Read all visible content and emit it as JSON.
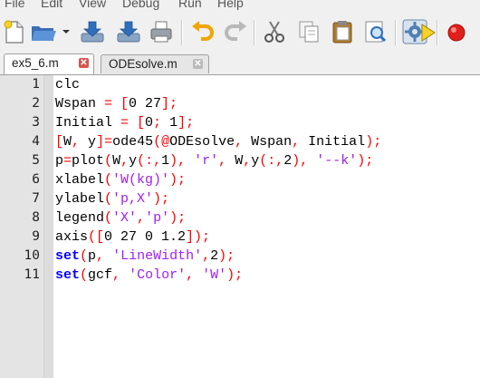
{
  "menu": {
    "items": [
      "File",
      "Edit",
      "View",
      "Debug",
      "Run",
      "Help"
    ]
  },
  "toolbar": {
    "buttons": [
      "new-file-icon",
      "open-folder-icon",
      "dropdown-arrow-icon",
      "import-icon",
      "export-icon",
      "print-icon",
      "undo-icon",
      "redo-icon",
      "cut-icon",
      "copy-icon",
      "paste-icon",
      "find-icon",
      "settings-gear-icon",
      "run-icon",
      "record-icon"
    ]
  },
  "tabs": [
    {
      "label": "ex5_6.m",
      "active": true
    },
    {
      "label": "ODEsolve.m",
      "active": false
    }
  ],
  "colors": {
    "keyword": "#0000ff",
    "string": "#a020f0",
    "operator": "#ff0000",
    "gutter": "#e4e4e4"
  },
  "editor": {
    "lines": [
      {
        "num": "1",
        "tokens": [
          {
            "t": "clc",
            "k": "plain"
          }
        ]
      },
      {
        "num": "2",
        "tokens": [
          {
            "t": "Wspan ",
            "k": "plain"
          },
          {
            "t": "= [",
            "k": "operator"
          },
          {
            "t": "0 27",
            "k": "plain"
          },
          {
            "t": "];",
            "k": "operator"
          }
        ]
      },
      {
        "num": "3",
        "tokens": [
          {
            "t": "Initial ",
            "k": "plain"
          },
          {
            "t": "= [",
            "k": "operator"
          },
          {
            "t": "0",
            "k": "plain"
          },
          {
            "t": "; ",
            "k": "operator"
          },
          {
            "t": "1",
            "k": "plain"
          },
          {
            "t": "];",
            "k": "operator"
          }
        ]
      },
      {
        "num": "4",
        "tokens": [
          {
            "t": "[",
            "k": "operator"
          },
          {
            "t": "W",
            "k": "plain"
          },
          {
            "t": ", ",
            "k": "operator"
          },
          {
            "t": "y",
            "k": "plain"
          },
          {
            "t": "]=",
            "k": "operator"
          },
          {
            "t": "ode45",
            "k": "plain"
          },
          {
            "t": "(@",
            "k": "operator"
          },
          {
            "t": "ODEsolve",
            "k": "plain"
          },
          {
            "t": ", ",
            "k": "operator"
          },
          {
            "t": "Wspan",
            "k": "plain"
          },
          {
            "t": ", ",
            "k": "operator"
          },
          {
            "t": "Initial",
            "k": "plain"
          },
          {
            "t": ");",
            "k": "operator"
          }
        ]
      },
      {
        "num": "5",
        "tokens": [
          {
            "t": "p",
            "k": "plain"
          },
          {
            "t": "=",
            "k": "operator"
          },
          {
            "t": "plot",
            "k": "plain"
          },
          {
            "t": "(",
            "k": "operator"
          },
          {
            "t": "W",
            "k": "plain"
          },
          {
            "t": ",",
            "k": "operator"
          },
          {
            "t": "y",
            "k": "plain"
          },
          {
            "t": "(:,",
            "k": "operator"
          },
          {
            "t": "1",
            "k": "plain"
          },
          {
            "t": "), ",
            "k": "operator"
          },
          {
            "t": "'r'",
            "k": "string"
          },
          {
            "t": ", ",
            "k": "operator"
          },
          {
            "t": "W",
            "k": "plain"
          },
          {
            "t": ",",
            "k": "operator"
          },
          {
            "t": "y",
            "k": "plain"
          },
          {
            "t": "(:,",
            "k": "operator"
          },
          {
            "t": "2",
            "k": "plain"
          },
          {
            "t": "), ",
            "k": "operator"
          },
          {
            "t": "'--k'",
            "k": "string"
          },
          {
            "t": ");",
            "k": "operator"
          }
        ]
      },
      {
        "num": "6",
        "tokens": [
          {
            "t": "xlabel",
            "k": "plain"
          },
          {
            "t": "(",
            "k": "operator"
          },
          {
            "t": "'W(kg)'",
            "k": "string"
          },
          {
            "t": ");",
            "k": "operator"
          }
        ]
      },
      {
        "num": "7",
        "tokens": [
          {
            "t": "ylabel",
            "k": "plain"
          },
          {
            "t": "(",
            "k": "operator"
          },
          {
            "t": "'p,X'",
            "k": "string"
          },
          {
            "t": ");",
            "k": "operator"
          }
        ]
      },
      {
        "num": "8",
        "tokens": [
          {
            "t": "legend",
            "k": "plain"
          },
          {
            "t": "(",
            "k": "operator"
          },
          {
            "t": "'X'",
            "k": "string"
          },
          {
            "t": ",",
            "k": "operator"
          },
          {
            "t": "'p'",
            "k": "string"
          },
          {
            "t": ");",
            "k": "operator"
          }
        ]
      },
      {
        "num": "9",
        "tokens": [
          {
            "t": "axis",
            "k": "plain"
          },
          {
            "t": "([",
            "k": "operator"
          },
          {
            "t": "0 27 0 1.2",
            "k": "plain"
          },
          {
            "t": "]);",
            "k": "operator"
          }
        ]
      },
      {
        "num": "10",
        "tokens": [
          {
            "t": "set",
            "k": "keyword"
          },
          {
            "t": "(",
            "k": "operator"
          },
          {
            "t": "p",
            "k": "plain"
          },
          {
            "t": ", ",
            "k": "operator"
          },
          {
            "t": "'LineWidth'",
            "k": "string"
          },
          {
            "t": ",",
            "k": "operator"
          },
          {
            "t": "2",
            "k": "plain"
          },
          {
            "t": ");",
            "k": "operator"
          }
        ]
      },
      {
        "num": "11",
        "tokens": [
          {
            "t": "set",
            "k": "keyword"
          },
          {
            "t": "(",
            "k": "operator"
          },
          {
            "t": "gcf",
            "k": "plain"
          },
          {
            "t": ", ",
            "k": "operator"
          },
          {
            "t": "'Color'",
            "k": "string"
          },
          {
            "t": ", ",
            "k": "operator"
          },
          {
            "t": "'W'",
            "k": "string"
          },
          {
            "t": ");",
            "k": "operator"
          }
        ]
      }
    ]
  }
}
